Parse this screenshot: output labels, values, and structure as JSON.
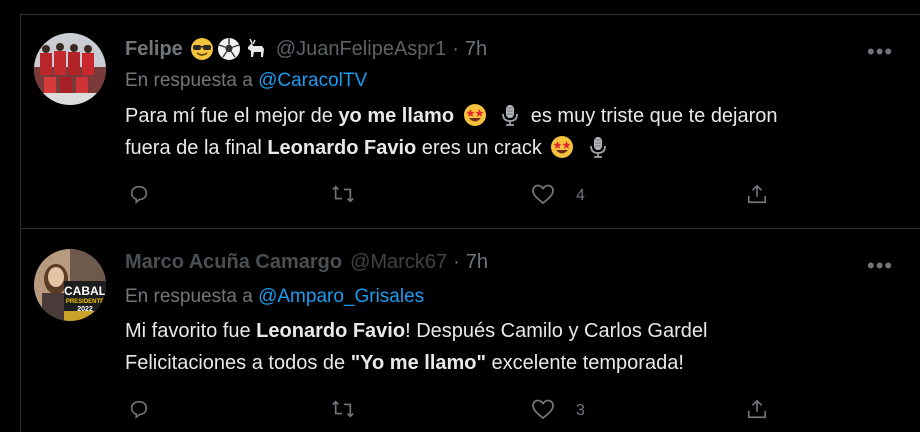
{
  "tweets": [
    {
      "author_name": "Felipe",
      "author_emojis": [
        "smiling-face-with-sunglasses",
        "soccer-ball",
        "goat"
      ],
      "handle": "@JuanFelipeAspr1",
      "dot": "·",
      "time": "7h",
      "reply_prefix": "En respuesta a",
      "reply_to": "@CaracolTV",
      "body_line1": {
        "t1": "Para mí fue el mejor de ",
        "b1": "yo me llamo",
        "t2": " es muy triste que te dejaron"
      },
      "body_line2": {
        "t1": "fuera de la final ",
        "b1": "Leonardo Favio",
        "t2": " eres un crack"
      },
      "likes": "4",
      "retweets": "",
      "replies": ""
    },
    {
      "author_name": "Marco Acuña Camargo",
      "handle": "@Marck67",
      "dot": "·",
      "time": "7h",
      "reply_prefix": "En respuesta a",
      "reply_to": "@Amparo_Grisales",
      "body_line1": {
        "t1": "Mi favorito fue ",
        "b1": "Leonardo Favio",
        "t2": "! Después Camilo y Carlos Gardel"
      },
      "body_line2": {
        "t1": "Felicitaciones a todos de ",
        "b1": "\"Yo me llamo\"",
        "t2": " excelente temporada!"
      },
      "avatar_text": {
        "line1": "CABAL",
        "line2": "PRESIDENTE",
        "line3": "2022"
      },
      "likes": "3",
      "retweets": "",
      "replies": ""
    }
  ],
  "more_label": "•••",
  "colors": {
    "background": "#000000",
    "text": "#e7e9ea",
    "muted": "#71767b",
    "link": "#1d9bf0",
    "border": "#2f3336"
  }
}
